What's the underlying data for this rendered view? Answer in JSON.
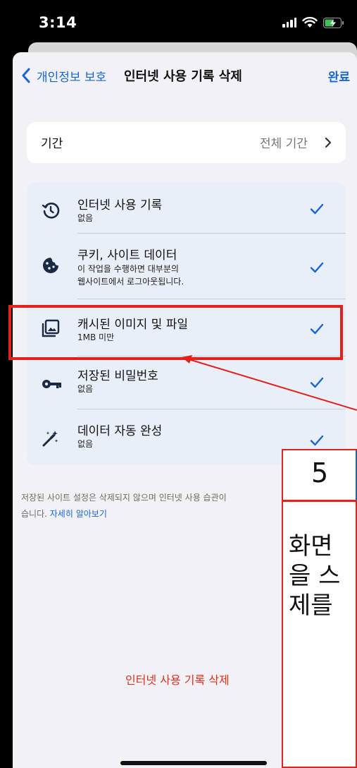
{
  "status_bar": {
    "time": "3:14"
  },
  "nav": {
    "back_label": "개인정보 보호",
    "title": "인터넷 사용 기록 삭제",
    "done_label": "완료"
  },
  "period": {
    "label": "기간",
    "value": "전체 기간"
  },
  "items": [
    {
      "title": "인터넷 사용 기록",
      "subtitle": "없음",
      "icon": "history-icon",
      "checked": true
    },
    {
      "title": "쿠키, 사이트 데이터",
      "subtitle": "이 작업을 수행하면 대부분의\n웹사이트에서 로그아웃됩니다.",
      "icon": "cookie-icon",
      "checked": true
    },
    {
      "title": "캐시된 이미지 및 파일",
      "subtitle": "1MB 미만",
      "icon": "images-icon",
      "checked": true
    },
    {
      "title": "저장된 비밀번호",
      "subtitle": "없음",
      "icon": "key-icon",
      "checked": true
    },
    {
      "title": "데이터 자동 완성",
      "subtitle": "없음",
      "icon": "magic-wand-icon",
      "checked": true
    }
  ],
  "footer": {
    "text": "저장된 사이트 설정은 삭제되지 않으며 인터넷 사용 습관이",
    "text2": "습니다.",
    "link": "자세히 알아보기"
  },
  "delete_button": "인터넷 사용 기록 삭제",
  "annotation": {
    "step": "5",
    "note": "화면\n을 스\n제를"
  },
  "colors": {
    "accent": "#1565d8",
    "destructive": "#e0301e",
    "annotation": "#e4211c"
  }
}
